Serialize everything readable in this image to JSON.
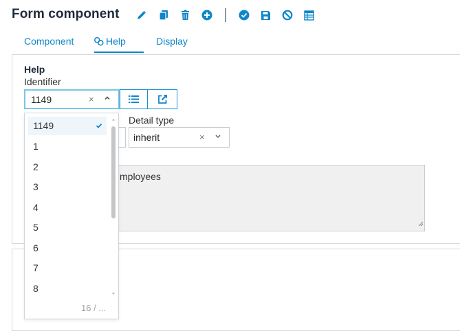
{
  "title": "Form component",
  "toolbar": {
    "items": [
      {
        "name": "edit-icon",
        "color": "#0e86c8"
      },
      {
        "name": "copy-icon",
        "color": "#0e86c8"
      },
      {
        "name": "trash-icon",
        "color": "#0e86c8"
      },
      {
        "name": "add-circle-icon",
        "color": "#0e86c8"
      },
      {
        "name": "check-circle-icon",
        "color": "#0e86c8"
      },
      {
        "name": "save-icon",
        "color": "#0e86c8"
      },
      {
        "name": "cancel-icon",
        "color": "#0e86c8"
      },
      {
        "name": "table-icon",
        "color": "#0e86c8"
      }
    ]
  },
  "tabs": {
    "component": "Component",
    "help": "Help",
    "display": "Display",
    "active": "Help"
  },
  "help": {
    "heading": "Help",
    "identifier_label": "Identifier",
    "identifier_value": "1149",
    "clear_symbol": "×",
    "list_button_icon": "list-icon",
    "open_button_icon": "external-link-icon"
  },
  "detail_type": {
    "label": "Detail type",
    "value": "inherit",
    "clear_symbol": "×"
  },
  "textarea": {
    "visible_text": "mployees"
  },
  "dropdown": {
    "options": [
      "1149",
      "1",
      "2",
      "3",
      "4",
      "5",
      "6",
      "7",
      "8"
    ],
    "selected": "1149",
    "count_text": "16 / ..."
  },
  "colors": {
    "accent": "#0e86c8",
    "focus_border": "#78c6e6"
  }
}
